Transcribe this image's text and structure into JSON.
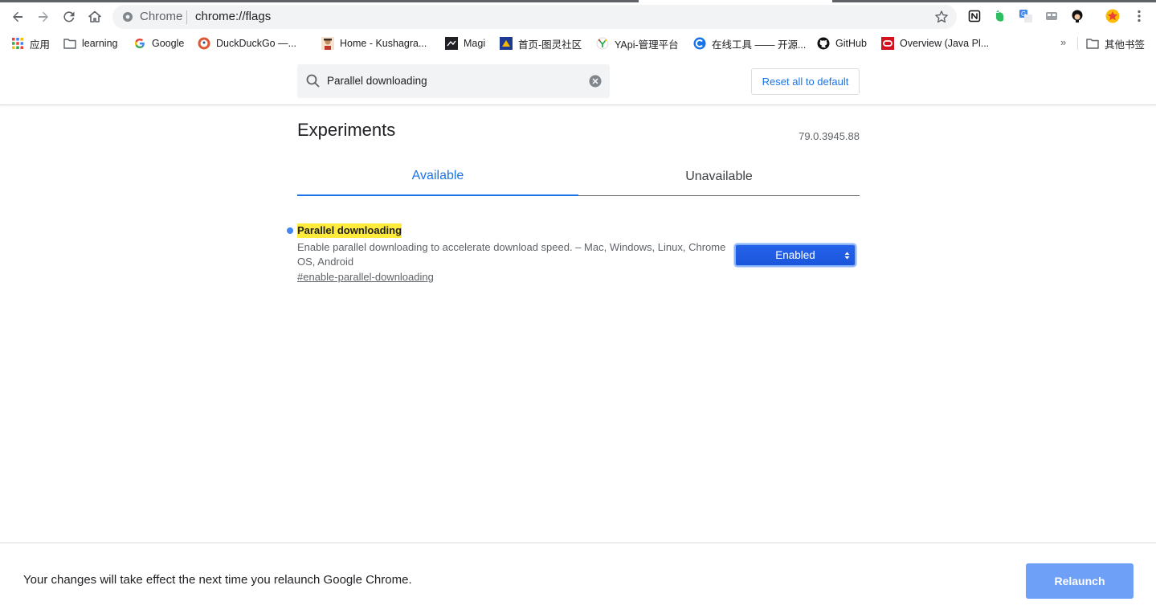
{
  "browser": {
    "omnibox_scheme": "Chrome",
    "omnibox_url": "chrome://flags",
    "back_icon": "arrow-left-icon",
    "forward_icon": "arrow-right-icon",
    "reload_icon": "reload-icon",
    "home_icon": "home-icon",
    "bookmark_star_icon": "star-icon"
  },
  "bookmarks": [
    {
      "label": "应用",
      "icon": "apps-grid-icon"
    },
    {
      "label": "learning",
      "icon": "folder-icon"
    },
    {
      "label": "Google",
      "icon": "google-icon"
    },
    {
      "label": "DuckDuckGo —...",
      "icon": "duckduckgo-icon"
    },
    {
      "label": "Home - Kushagra...",
      "icon": "avatar-icon"
    },
    {
      "label": "Magi",
      "icon": "magi-icon"
    },
    {
      "label": "首页-图灵社区",
      "icon": "turing-icon"
    },
    {
      "label": "YApi-管理平台",
      "icon": "yapi-icon"
    },
    {
      "label": "在线工具 —— 开源...",
      "icon": "tools-icon"
    },
    {
      "label": "GitHub",
      "icon": "github-icon"
    },
    {
      "label": "Overview (Java Pl...",
      "icon": "java-icon"
    }
  ],
  "bookmarks_overflow": "»",
  "other_bookmarks": {
    "label": "其他书签",
    "icon": "folder-icon"
  },
  "search": {
    "value": "Parallel downloading"
  },
  "reset_button": "Reset all to default",
  "page_title": "Experiments",
  "version": "79.0.3945.88",
  "tabs": [
    {
      "label": "Available",
      "active": true
    },
    {
      "label": "Unavailable",
      "active": false
    }
  ],
  "experiment": {
    "name": "Parallel downloading",
    "description": "Enable parallel downloading to accelerate download speed. – Mac, Windows, Linux, Chrome OS, Android",
    "link": "#enable-parallel-downloading",
    "selected_value": "Enabled"
  },
  "footer": {
    "message": "Your changes will take effect the next time you relaunch Google Chrome.",
    "relaunch_button": "Relaunch"
  },
  "colors": {
    "accent": "#1a73e8",
    "highlight": "#ffeb3b",
    "relaunch": "#6ea0f7"
  }
}
